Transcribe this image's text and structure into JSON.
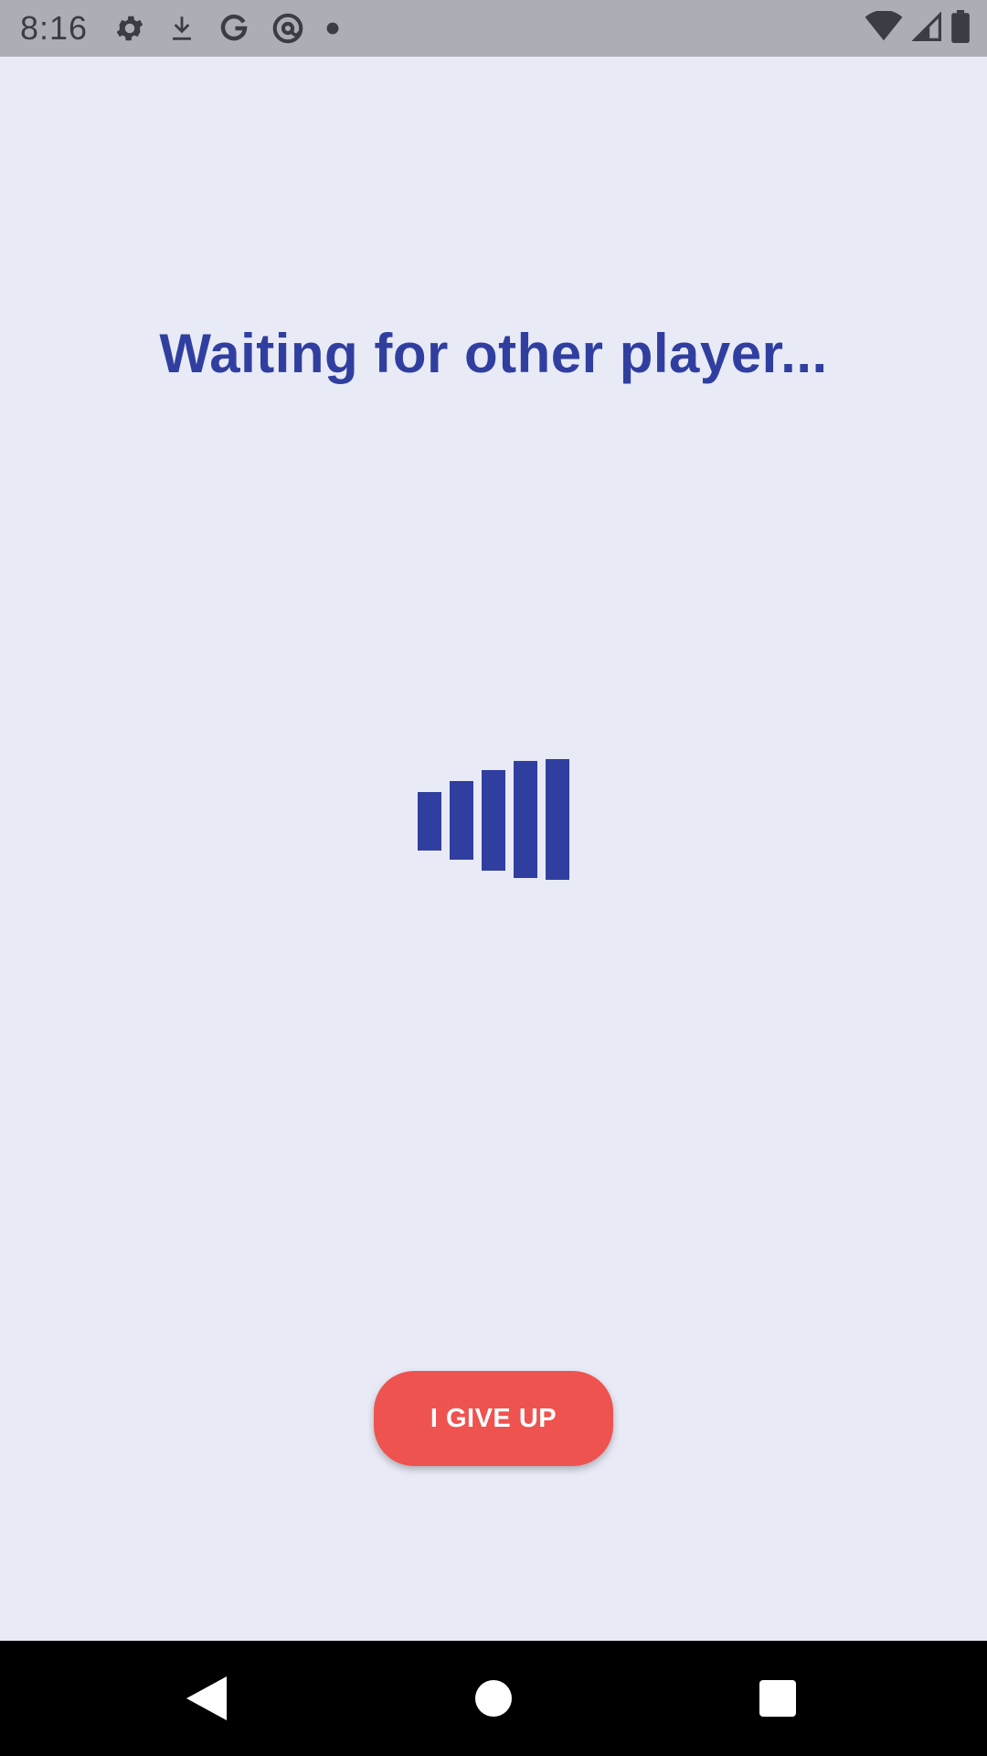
{
  "status_bar": {
    "time": "8:16",
    "left_icons": [
      "gear-icon",
      "download-icon",
      "google-icon",
      "at-sign-icon",
      "dot-icon"
    ],
    "right_icons": [
      "wifi-icon",
      "cell-signal-icon",
      "battery-icon"
    ]
  },
  "main": {
    "title": "Waiting for other player...",
    "loader_icon": "loading-bars-icon",
    "loader_color": "#303f9f"
  },
  "actions": {
    "give_up_label": "I GIVE UP",
    "give_up_color": "#ef5350"
  },
  "nav_bar": {
    "items": [
      "back-icon",
      "home-icon",
      "recents-icon"
    ]
  },
  "colors": {
    "background": "#e8eaf6",
    "status_bar": "#adadb6",
    "accent": "#303f9f"
  }
}
